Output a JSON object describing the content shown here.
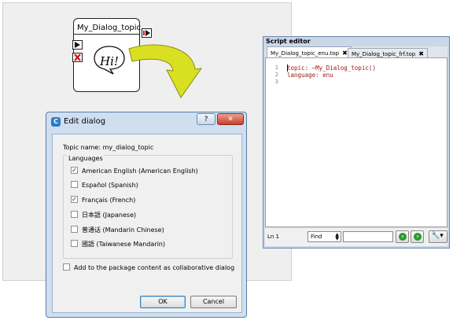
{
  "box": {
    "title": "My_Dialog_topic",
    "bubble_text": "Hi!"
  },
  "script_editor": {
    "title": "Script editor",
    "tabs": [
      {
        "label": "My_Dialog_topic_enu.top",
        "close": "✖"
      },
      {
        "label": "My_Dialog_topic_frf.top",
        "close": "✖"
      }
    ],
    "line_numbers": [
      "1",
      "2",
      "3"
    ],
    "code_lines": [
      "topic: ~My_Dialog_topic()",
      "language: enu",
      ""
    ],
    "status_line": "Ln 1",
    "find_label": "Find",
    "find_value": "",
    "prev_icon": "arrow-left-icon",
    "next_icon": "arrow-right-icon",
    "tools_icon": "wrench-icon"
  },
  "dialog": {
    "title": "Edit dialog",
    "help_label": "?",
    "close_label": "✕",
    "topic_name_line": "Topic name: my_dialog_topic",
    "languages_label": "Languages",
    "languages": [
      {
        "label": "American English (American English)",
        "checked": true
      },
      {
        "label": "Español (Spanish)",
        "checked": false
      },
      {
        "label": "Français (French)",
        "checked": true
      },
      {
        "label": "日本語 (Japanese)",
        "checked": false
      },
      {
        "label": "普通话 (Mandarin Chinese)",
        "checked": false
      },
      {
        "label": "國語 (Taiwanese Mandarin)",
        "checked": false
      }
    ],
    "collab_label": "Add to the package content as collaborative dialog",
    "collab_checked": false,
    "ok_label": "OK",
    "cancel_label": "Cancel"
  },
  "colors": {
    "code_text": "#a31515",
    "arrow_fill": "#d9e021",
    "dialog_frame": "#cfdff0",
    "nav_button_green": "#2a9a2a"
  }
}
